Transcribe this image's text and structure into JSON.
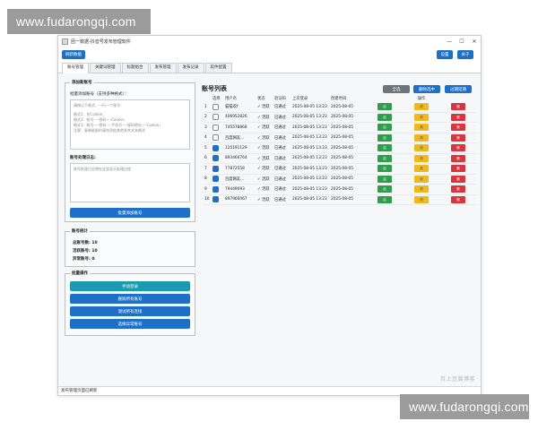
{
  "watermark": {
    "top": "www.fudarongqi.com",
    "bottom": "www.fudarongqi.com"
  },
  "window": {
    "title": "团一数据-抖音号发布管理软件",
    "controls": [
      "—",
      "☐",
      "✕"
    ]
  },
  "topbar": {
    "left_button": "刷新数据",
    "right_buttons": [
      "设置",
      "关于"
    ]
  },
  "tabs": [
    "账号管理",
    "关键词管理",
    "标题组合",
    "发布管理",
    "发布记录",
    "软件配置"
  ],
  "left": {
    "add_group_title": "添加新账号",
    "batch_add_label": "批量添加账号（支持多种格式）：",
    "textarea_lines": [
      "请按以下格式，一行一个账号：",
      "",
      "格式1：仅Cookie；",
      "格式2：账号----密码----Cookie；",
      "格式3：账号----密码----手机号----接码地址----Cookie；",
      "注意：复制粘贴时请勿添加其他多余文本格式"
    ],
    "log_label": "账号处理日志:",
    "log_placeholder": "账号处理日志将在这里显示处理过程",
    "batch_add_button": "批量添加账号",
    "stats_group_title": "账号统计",
    "stats": [
      "总账号数: 10",
      "活跃账号: 10",
      "异常账号: 0"
    ],
    "batch_group_title": "批量操作",
    "batch_buttons": [
      "手动登录",
      "删除所有账号",
      "测试所有连接",
      "选择异常账号"
    ]
  },
  "right": {
    "title": "账号列表",
    "buttons": [
      "全选",
      "删除选中",
      "过期延期"
    ],
    "columns": [
      "选择",
      "用户名",
      "状态",
      "验证码",
      "上次登录",
      "创建时间",
      "",
      "操作",
      ""
    ],
    "op_labels": [
      "启",
      "改",
      "删"
    ],
    "rows": [
      {
        "n": "1",
        "checked": false,
        "user": "猫猫欢f",
        "status": "✓ 活跃",
        "verify": "已通过",
        "last": "2025-08-05 13:23",
        "created": "2025-08-05"
      },
      {
        "n": "2",
        "checked": false,
        "user": "406952826",
        "status": "✓ 活跃",
        "verify": "已通过",
        "last": "2025-08-05 13:23",
        "created": "2025-08-05"
      },
      {
        "n": "3",
        "checked": false,
        "user": "745578868",
        "status": "✓ 活跃",
        "verify": "已通过",
        "last": "2025-08-05 13:23",
        "created": "2025-08-05"
      },
      {
        "n": "4",
        "checked": false,
        "user": "百度网友...",
        "status": "✓ 活跃",
        "verify": "已通过",
        "last": "2025-08-05 13:23",
        "created": "2025-08-05"
      },
      {
        "n": "5",
        "checked": true,
        "user": "125191129",
        "status": "✓ 活跃",
        "verify": "已通过",
        "last": "2025-08-05 13:23",
        "created": "2025-08-05"
      },
      {
        "n": "6",
        "checked": true,
        "user": "893466764",
        "status": "✓ 活跃",
        "verify": "已通过",
        "last": "2025-08-05 13:23",
        "created": "2025-08-05"
      },
      {
        "n": "7",
        "checked": true,
        "user": "77872558",
        "status": "✓ 活跃",
        "verify": "已通过",
        "last": "2025-08-05 13:23",
        "created": "2025-08-05"
      },
      {
        "n": "8",
        "checked": true,
        "user": "百度网友...",
        "status": "✓ 活跃",
        "verify": "已通过",
        "last": "2025-08-05 13:23",
        "created": "2025-08-05"
      },
      {
        "n": "9",
        "checked": true,
        "user": "79449093",
        "status": "✓ 活跃",
        "verify": "已通过",
        "last": "2025-08-05 13:23",
        "created": "2025-08-05"
      },
      {
        "n": "10",
        "checked": true,
        "user": "897966067",
        "status": "✓ 活跃",
        "verify": "已通过",
        "last": "2025-08-05 13:23",
        "created": "2025-08-05"
      }
    ]
  },
  "statusbar": "发布管理页面已刷新",
  "corner_logo": "百上豆腐博客"
}
